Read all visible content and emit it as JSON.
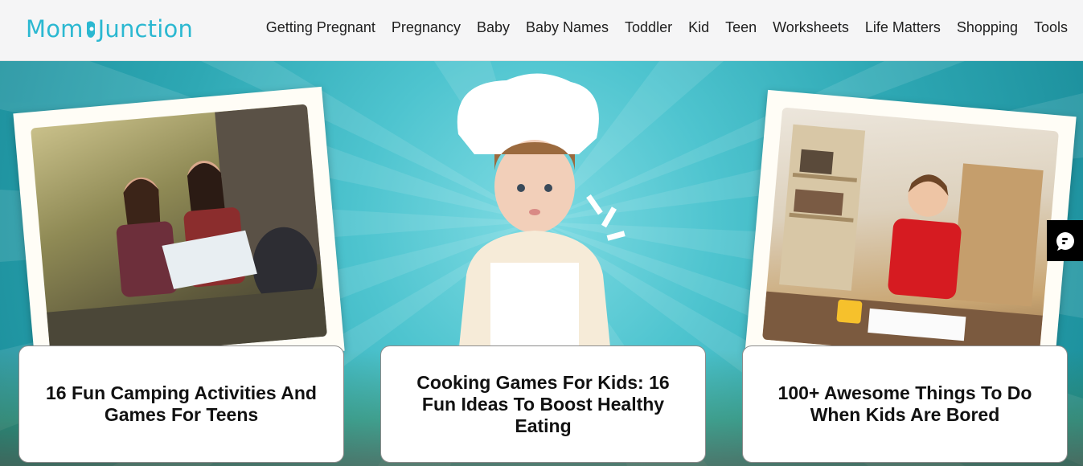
{
  "header": {
    "logo_text_1": "Mom",
    "logo_text_2": "Junction",
    "nav": [
      {
        "label": "Getting Pregnant"
      },
      {
        "label": "Pregnancy"
      },
      {
        "label": "Baby"
      },
      {
        "label": "Baby Names"
      },
      {
        "label": "Toddler"
      },
      {
        "label": "Kid"
      },
      {
        "label": "Teen"
      },
      {
        "label": "Worksheets"
      },
      {
        "label": "Life Matters"
      },
      {
        "label": "Shopping"
      },
      {
        "label": "Tools"
      }
    ]
  },
  "cards": [
    {
      "title": "16 Fun Camping Activities And Games For Teens"
    },
    {
      "title": "Cooking Games For Kids: 16 Fun Ideas To Boost Healthy Eating"
    },
    {
      "title": "100+ Awesome Things To Do When Kids Are Bored"
    }
  ],
  "colors": {
    "brand": "#2bb8d1",
    "hero_bg": "#3bb5c2"
  },
  "icons": {
    "feedback": "feedback-icon"
  }
}
